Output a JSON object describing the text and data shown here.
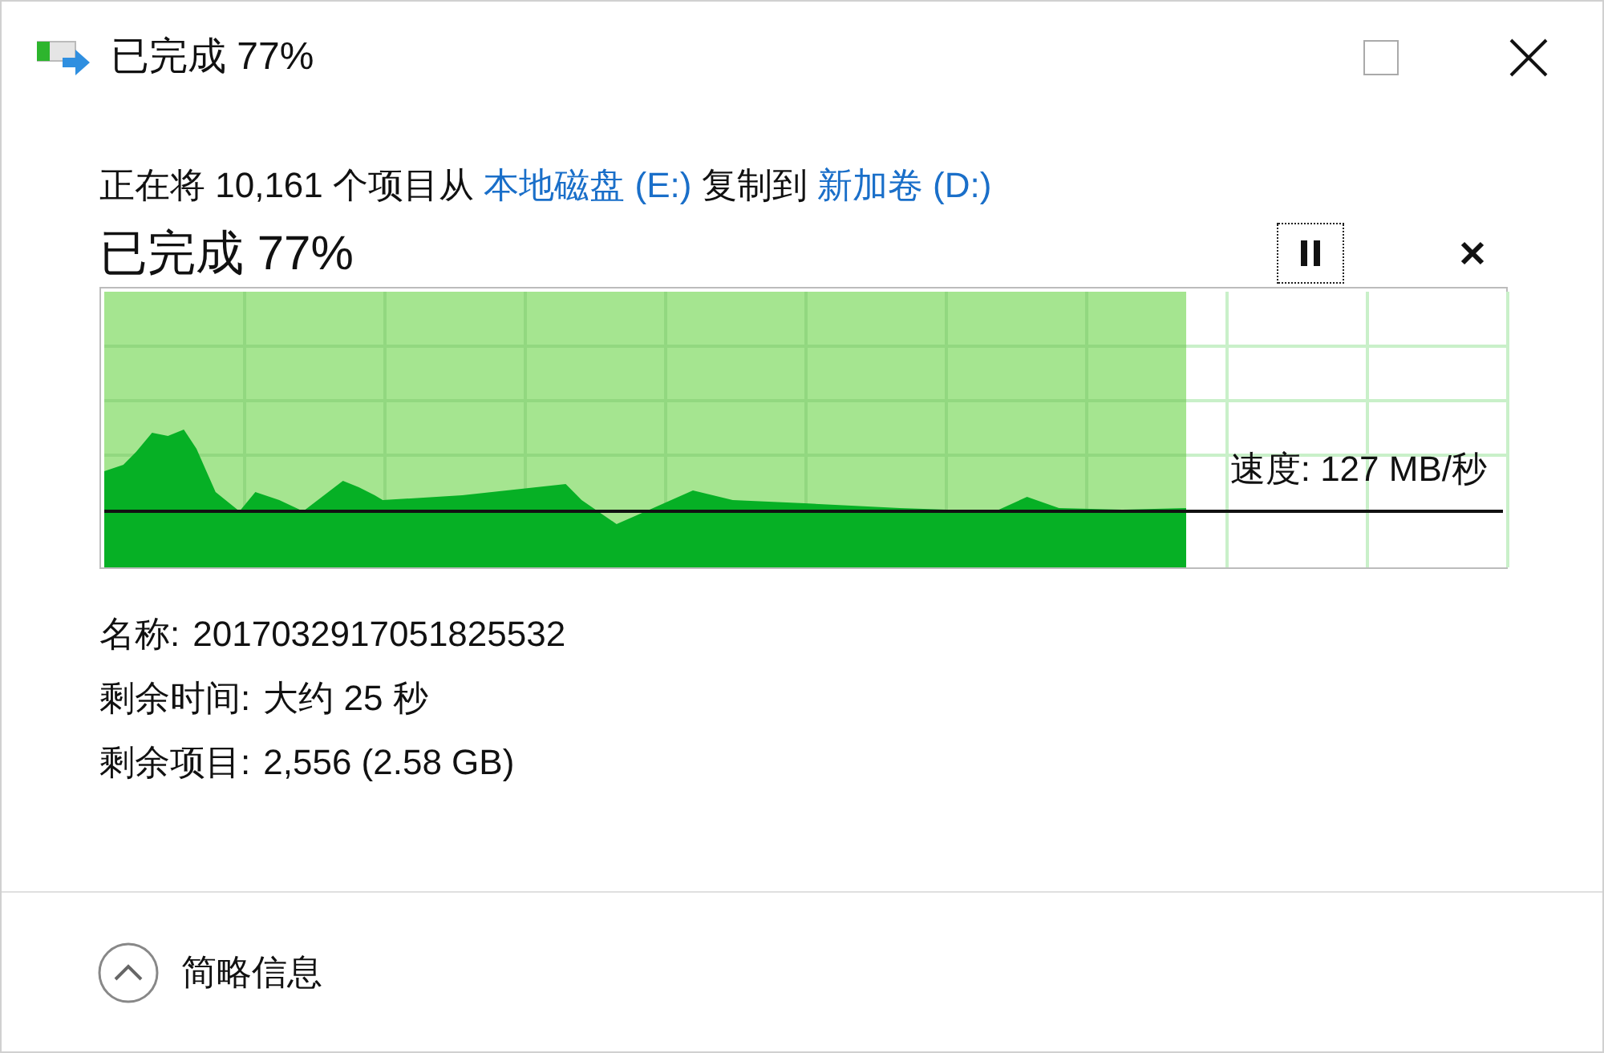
{
  "window": {
    "title": "已完成 77%"
  },
  "description": [
    {
      "kind": "text",
      "text": "正在将 10,161 个项目从 "
    },
    {
      "kind": "link",
      "text": "本地磁盘 (E:)"
    },
    {
      "kind": "text",
      "text": " 复制到 "
    },
    {
      "kind": "link",
      "text": "新加卷 (D:)"
    }
  ],
  "status": "已完成 77%",
  "progress": {
    "level": 0.77,
    "speed": "速度: 127 MB/秒"
  },
  "details": [
    {
      "label": "名称:",
      "value": "2017032917051825532"
    },
    {
      "label": "剩余时间:",
      "value": "大约 25 秒"
    },
    {
      "label": "剩余项目:",
      "value": "2,556 (2.58 GB)"
    }
  ],
  "footer": {
    "toggle": "简略信息",
    "expanded": true
  }
}
